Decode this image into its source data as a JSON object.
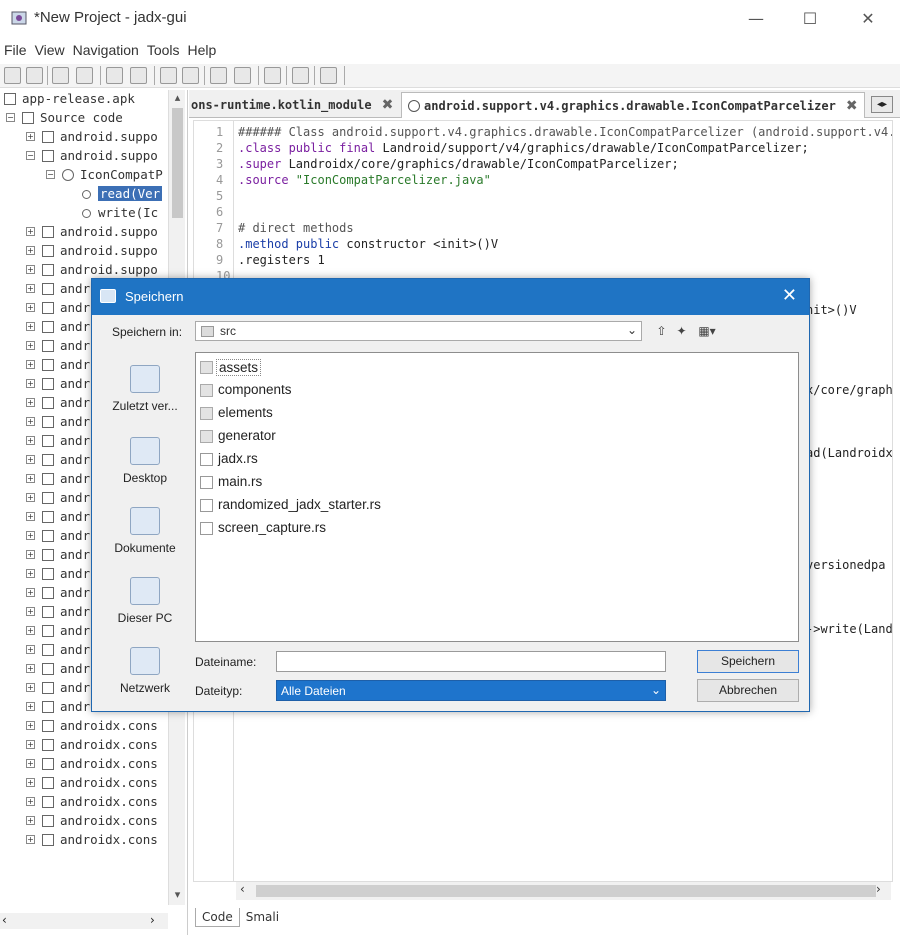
{
  "window": {
    "title": "*New Project - jadx-gui",
    "minimize": "—",
    "maximize": "☐",
    "close": "✕"
  },
  "menu": [
    "File",
    "View",
    "Navigation",
    "Tools",
    "Help"
  ],
  "tree": {
    "root": "app-release.apk",
    "source": "Source code",
    "pkg1": "android.suppo",
    "pkg2": "android.suppo",
    "class": "IconCompatP",
    "method_read": "read(Ver",
    "method_write": "write(Ic",
    "packages_short": [
      "android.suppo",
      "android.suppo",
      "android.suppo",
      "andr",
      "andr",
      "andr",
      "andr",
      "andr",
      "andr",
      "andr",
      "andr",
      "andr",
      "andr",
      "andr",
      "andr",
      "andr",
      "andr",
      "andr",
      "andr",
      "andr",
      "andr",
      "andr",
      "andr",
      "andr"
    ],
    "packages_long": [
      "androidx.card",
      "androidx.coll",
      "androidx.cons",
      "androidx.cons",
      "androidx.cons",
      "androidx.cons",
      "androidx.cons",
      "androidx.cons",
      "androidx.cons"
    ]
  },
  "tabs": {
    "tab1": "ons-runtime.kotlin_module",
    "tab2": "android.support.v4.graphics.drawable.IconCompatParcelizer",
    "close": "✖"
  },
  "editor": {
    "lines": [
      {
        "n": "1",
        "text": "###### Class android.support.v4.graphics.drawable.IconCompatParcelizer (android.support.v4.gra"
      },
      {
        "n": "2",
        "kw": ".class public final",
        "text": " Landroid/support/v4/graphics/drawable/IconCompatParcelizer;"
      },
      {
        "n": "3",
        "kw": ".super",
        "text": " Landroidx/core/graphics/drawable/IconCompatParcelizer;"
      },
      {
        "n": "4",
        "kw": ".source",
        "str": " \"IconCompatParcelizer.java\""
      },
      {
        "n": "5",
        "text": ""
      },
      {
        "n": "6",
        "text": ""
      },
      {
        "n": "7",
        "text": "# direct methods"
      },
      {
        "n": "8",
        "kw": ".method public",
        "text": " constructor <init>()V"
      },
      {
        "n": "9",
        "text": "    .registers 1"
      },
      {
        "n": "10",
        "text": ""
      }
    ],
    "frag1": "nit>()V",
    "frag2": "x/core/graph",
    "frag3": "ad(Landroidx",
    "frag4": "versionedpa",
    "frag5": "->write(Land"
  },
  "bottom_tabs": [
    "Code",
    "Smali"
  ],
  "dialog": {
    "title": "Speichern",
    "lookin_label": "Speichern in:",
    "lookin_value": "src",
    "places": [
      "Zuletzt ver...",
      "Desktop",
      "Dokumente",
      "Dieser PC",
      "Netzwerk"
    ],
    "files": [
      {
        "name": "assets",
        "type": "folder"
      },
      {
        "name": "components",
        "type": "folder"
      },
      {
        "name": "elements",
        "type": "folder"
      },
      {
        "name": "generator",
        "type": "folder"
      },
      {
        "name": "jadx.rs",
        "type": "file"
      },
      {
        "name": "main.rs",
        "type": "file"
      },
      {
        "name": "randomized_jadx_starter.rs",
        "type": "file"
      },
      {
        "name": "screen_capture.rs",
        "type": "file"
      }
    ],
    "filename_label": "Dateiname:",
    "filename_value": "",
    "filetype_label": "Dateityp:",
    "filetype_value": "Alle Dateien",
    "save_button": "Speichern",
    "cancel_button": "Abbrechen"
  }
}
